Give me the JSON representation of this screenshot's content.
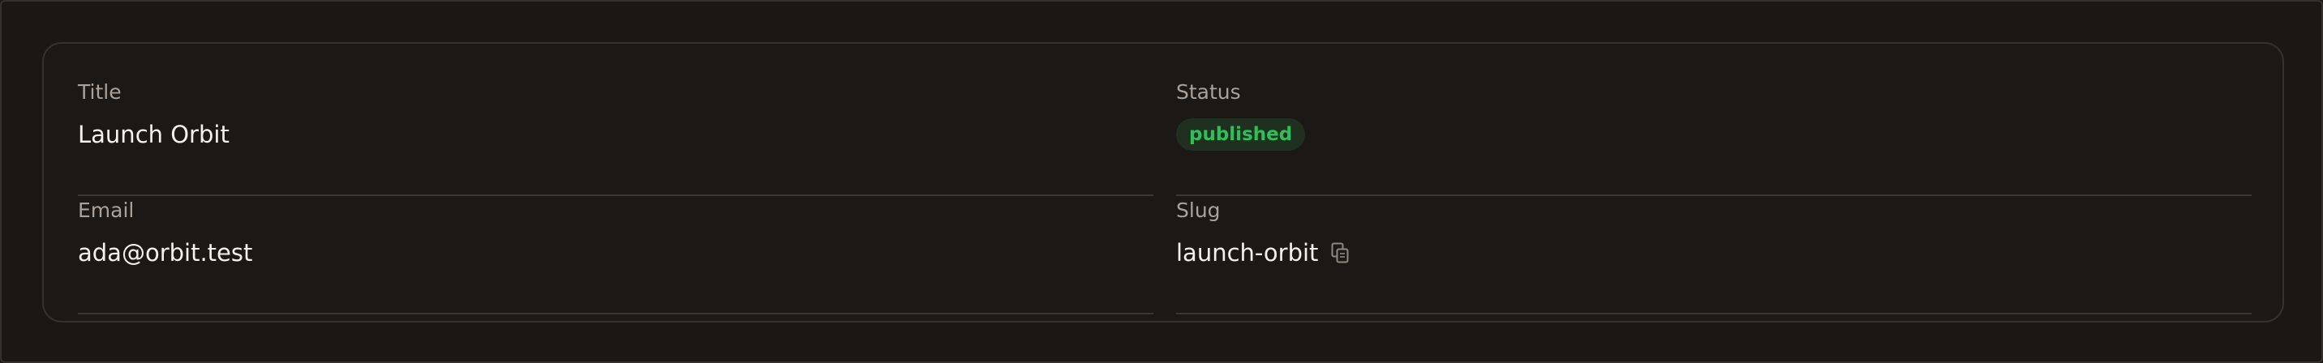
{
  "fields": {
    "title": {
      "label": "Title",
      "value": "Launch Orbit"
    },
    "status": {
      "label": "Status",
      "value": "published"
    },
    "email": {
      "label": "Email",
      "value": "ada@orbit.test"
    },
    "slug": {
      "label": "Slug",
      "value": "launch-orbit",
      "action_icon": "copy-icon"
    }
  },
  "colors": {
    "background": "#1b1714",
    "status_badge_bg": "#1f3021",
    "status_badge_text": "#2fbf59",
    "label_text": "#a9a19a",
    "value_text": "#f4f0ec"
  }
}
